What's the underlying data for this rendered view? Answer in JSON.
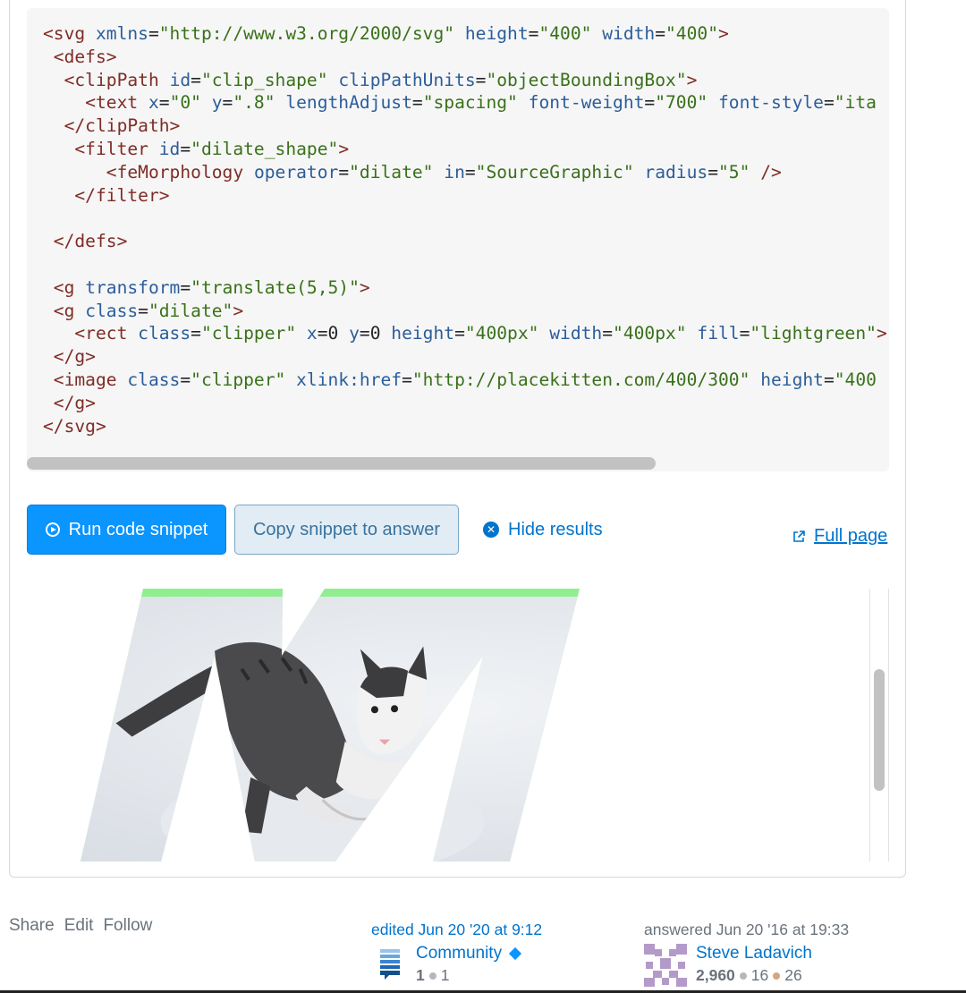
{
  "code": {
    "lines": [
      [
        [
          "tag",
          "<svg "
        ],
        [
          "at",
          "xmlns"
        ],
        [
          "pl",
          "="
        ],
        [
          "st",
          "\"http://www.w3.org/2000/svg\""
        ],
        [
          "pl",
          " "
        ],
        [
          "at",
          "height"
        ],
        [
          "pl",
          "="
        ],
        [
          "st",
          "\"400\""
        ],
        [
          "pl",
          " "
        ],
        [
          "at",
          "width"
        ],
        [
          "pl",
          "="
        ],
        [
          "st",
          "\"400\""
        ],
        [
          "tag",
          ">"
        ]
      ],
      [
        [
          "pl",
          " "
        ],
        [
          "tag",
          "<defs>"
        ]
      ],
      [
        [
          "pl",
          "  "
        ],
        [
          "tag",
          "<clipPath "
        ],
        [
          "at",
          "id"
        ],
        [
          "pl",
          "="
        ],
        [
          "st",
          "\"clip_shape\""
        ],
        [
          "pl",
          " "
        ],
        [
          "at",
          "clipPathUnits"
        ],
        [
          "pl",
          "="
        ],
        [
          "st",
          "\"objectBoundingBox\""
        ],
        [
          "tag",
          ">"
        ]
      ],
      [
        [
          "pl",
          "    "
        ],
        [
          "tag",
          "<text "
        ],
        [
          "at",
          "x"
        ],
        [
          "pl",
          "="
        ],
        [
          "st",
          "\"0\""
        ],
        [
          "pl",
          " "
        ],
        [
          "at",
          "y"
        ],
        [
          "pl",
          "="
        ],
        [
          "st",
          "\".8\""
        ],
        [
          "pl",
          " "
        ],
        [
          "at",
          "lengthAdjust"
        ],
        [
          "pl",
          "="
        ],
        [
          "st",
          "\"spacing\""
        ],
        [
          "pl",
          " "
        ],
        [
          "at",
          "font-weight"
        ],
        [
          "pl",
          "="
        ],
        [
          "st",
          "\"700\""
        ],
        [
          "pl",
          " "
        ],
        [
          "at",
          "font-style"
        ],
        [
          "pl",
          "="
        ],
        [
          "st",
          "\"ita"
        ]
      ],
      [
        [
          "pl",
          "  "
        ],
        [
          "tag",
          "</clipPath>"
        ]
      ],
      [
        [
          "pl",
          "   "
        ],
        [
          "tag",
          "<filter "
        ],
        [
          "at",
          "id"
        ],
        [
          "pl",
          "="
        ],
        [
          "st",
          "\"dilate_shape\""
        ],
        [
          "tag",
          ">"
        ]
      ],
      [
        [
          "pl",
          "      "
        ],
        [
          "tag",
          "<feMorphology "
        ],
        [
          "at",
          "operator"
        ],
        [
          "pl",
          "="
        ],
        [
          "st",
          "\"dilate\""
        ],
        [
          "pl",
          " "
        ],
        [
          "at",
          "in"
        ],
        [
          "pl",
          "="
        ],
        [
          "st",
          "\"SourceGraphic\""
        ],
        [
          "pl",
          " "
        ],
        [
          "at",
          "radius"
        ],
        [
          "pl",
          "="
        ],
        [
          "st",
          "\"5\""
        ],
        [
          "pl",
          " "
        ],
        [
          "tag",
          "/>"
        ]
      ],
      [
        [
          "pl",
          "   "
        ],
        [
          "tag",
          "</filter>"
        ]
      ],
      [
        [
          "pl",
          ""
        ]
      ],
      [
        [
          "pl",
          " "
        ],
        [
          "tag",
          "</defs>"
        ]
      ],
      [
        [
          "pl",
          ""
        ]
      ],
      [
        [
          "pl",
          " "
        ],
        [
          "tag",
          "<g "
        ],
        [
          "at",
          "transform"
        ],
        [
          "pl",
          "="
        ],
        [
          "st",
          "\"translate(5,5)\""
        ],
        [
          "tag",
          ">"
        ]
      ],
      [
        [
          "pl",
          " "
        ],
        [
          "tag",
          "<g "
        ],
        [
          "at",
          "class"
        ],
        [
          "pl",
          "="
        ],
        [
          "st",
          "\"dilate\""
        ],
        [
          "tag",
          ">"
        ]
      ],
      [
        [
          "pl",
          "   "
        ],
        [
          "tag",
          "<rect "
        ],
        [
          "at",
          "class"
        ],
        [
          "pl",
          "="
        ],
        [
          "st",
          "\"clipper\""
        ],
        [
          "pl",
          " "
        ],
        [
          "at",
          "x"
        ],
        [
          "pl",
          "=0 "
        ],
        [
          "at",
          "y"
        ],
        [
          "pl",
          "=0 "
        ],
        [
          "at",
          "height"
        ],
        [
          "pl",
          "="
        ],
        [
          "st",
          "\"400px\""
        ],
        [
          "pl",
          " "
        ],
        [
          "at",
          "width"
        ],
        [
          "pl",
          "="
        ],
        [
          "st",
          "\"400px\""
        ],
        [
          "pl",
          " "
        ],
        [
          "at",
          "fill"
        ],
        [
          "pl",
          "="
        ],
        [
          "st",
          "\"lightgreen\""
        ],
        [
          "tag",
          ">"
        ]
      ],
      [
        [
          "pl",
          " "
        ],
        [
          "tag",
          "</g>"
        ]
      ],
      [
        [
          "pl",
          " "
        ],
        [
          "tag",
          "<image "
        ],
        [
          "at",
          "class"
        ],
        [
          "pl",
          "="
        ],
        [
          "st",
          "\"clipper\""
        ],
        [
          "pl",
          " "
        ],
        [
          "at",
          "xlink:href"
        ],
        [
          "pl",
          "="
        ],
        [
          "st",
          "\"http://placekitten.com/400/300\""
        ],
        [
          "pl",
          " "
        ],
        [
          "at",
          "height"
        ],
        [
          "pl",
          "="
        ],
        [
          "st",
          "\"400"
        ]
      ],
      [
        [
          "pl",
          " "
        ],
        [
          "tag",
          "</g>"
        ]
      ],
      [
        [
          "tag",
          "</svg>"
        ]
      ]
    ]
  },
  "buttons": {
    "run": "Run code snippet",
    "copy": "Copy snippet to answer",
    "hide": "Hide results",
    "full_page": "Full page"
  },
  "post_menu": {
    "share": "Share",
    "edit": "Edit",
    "follow": "Follow"
  },
  "edited": {
    "action": "edited Jun 20 '20 at 9:12",
    "user": "Community",
    "rep": "1",
    "silver": "1"
  },
  "answered": {
    "action": "answered Jun 20 '16 at 19:33",
    "user": "Steve Ladavich",
    "rep": "2,960",
    "silver": "16",
    "bronze": "26"
  },
  "colors": {
    "accent": "#0a95ff",
    "link": "#0074cc",
    "outline_green": "#90ee90"
  },
  "icons": [
    "run-icon",
    "close-circle-icon",
    "external-link-icon",
    "community-avatar",
    "identicon-avatar",
    "moderator-diamond-icon"
  ]
}
